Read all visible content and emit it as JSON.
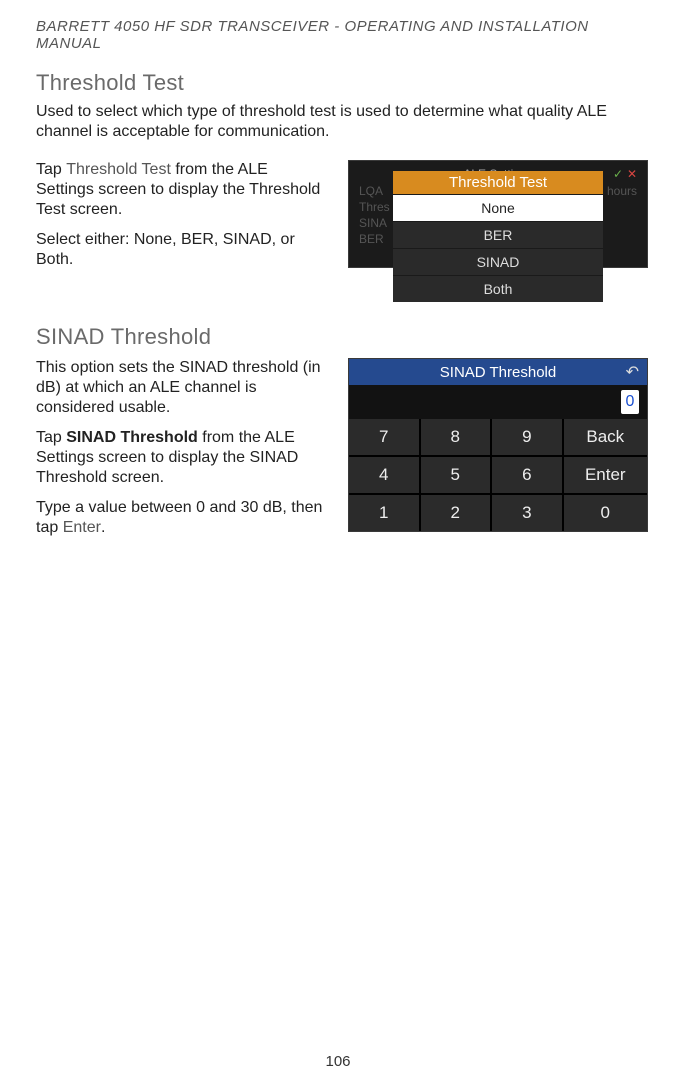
{
  "header": "BARRETT 4050 HF SDR TRANSCEIVER - OPERATING AND INSTALLATION MANUAL",
  "section1": {
    "title": "Threshold Test",
    "intro": "Used to select which type of threshold test is used to determine what quality ALE channel is acceptable for communication.",
    "p1_pre": "Tap ",
    "p1_label": "Threshold Test",
    "p1_post": " from the ALE Settings screen to display the Threshold Test screen.",
    "p2": "Select either: None, BER, SINAD, or Both."
  },
  "threshold_popup": {
    "bg_title": "ALE Settings",
    "bg_left": [
      "LQA",
      "Thres",
      "SINA",
      "BER"
    ],
    "bg_right_hours": "hours",
    "header": "Threshold Test",
    "options": [
      "None",
      "BER",
      "SINAD",
      "Both"
    ],
    "selected": "None",
    "tick": "✓",
    "x": "✕"
  },
  "section2": {
    "title": "SINAD Threshold",
    "p1": "This option sets the SINAD threshold (in dB) at which an ALE channel is considered usable.",
    "p2_pre": "Tap ",
    "p2_label": "SINAD Threshold",
    "p2_post": " from the ALE Settings screen to display the SINAD Threshold screen.",
    "p3_pre": "Type a value between 0 and 30 dB, then tap ",
    "p3_label": "Enter",
    "p3_post": "."
  },
  "sinad_shot": {
    "title": "SINAD Threshold",
    "back_arrow": "↶",
    "display_value": "0",
    "keys": [
      "7",
      "8",
      "9",
      "Back",
      "4",
      "5",
      "6",
      "Enter",
      "1",
      "2",
      "3",
      "0"
    ]
  },
  "page_number": "106"
}
